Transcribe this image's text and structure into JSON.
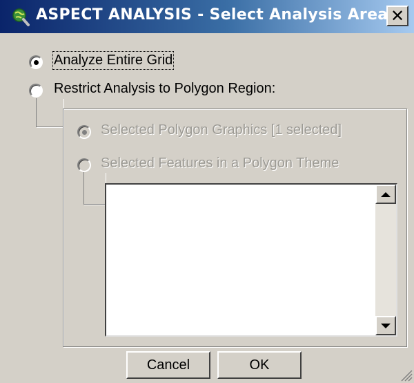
{
  "window": {
    "title": "ASPECT ANALYSIS - Select Analysis Area:",
    "app_icon": "globe-magnifier-icon",
    "close_icon": "close-icon",
    "close_glyph": "✕"
  },
  "options": {
    "entire_grid": {
      "label": "Analyze Entire Grid",
      "selected": true
    },
    "restrict_polygon": {
      "label": "Restrict Analysis to Polygon Region:",
      "selected": false
    }
  },
  "sub_options": {
    "enabled": false,
    "polygon_graphics": {
      "label": "Selected Polygon Graphics [1 selected]",
      "selected": true
    },
    "polygon_features": {
      "label": "Selected Features in a Polygon Theme",
      "selected": false
    }
  },
  "theme_list": {
    "items": []
  },
  "buttons": {
    "cancel": "Cancel",
    "ok": "OK"
  },
  "colors": {
    "titlebar_start": "#0a246a",
    "titlebar_end": "#a6caf0",
    "face": "#d4d0c8",
    "disabled_text": "#9c9a94"
  }
}
